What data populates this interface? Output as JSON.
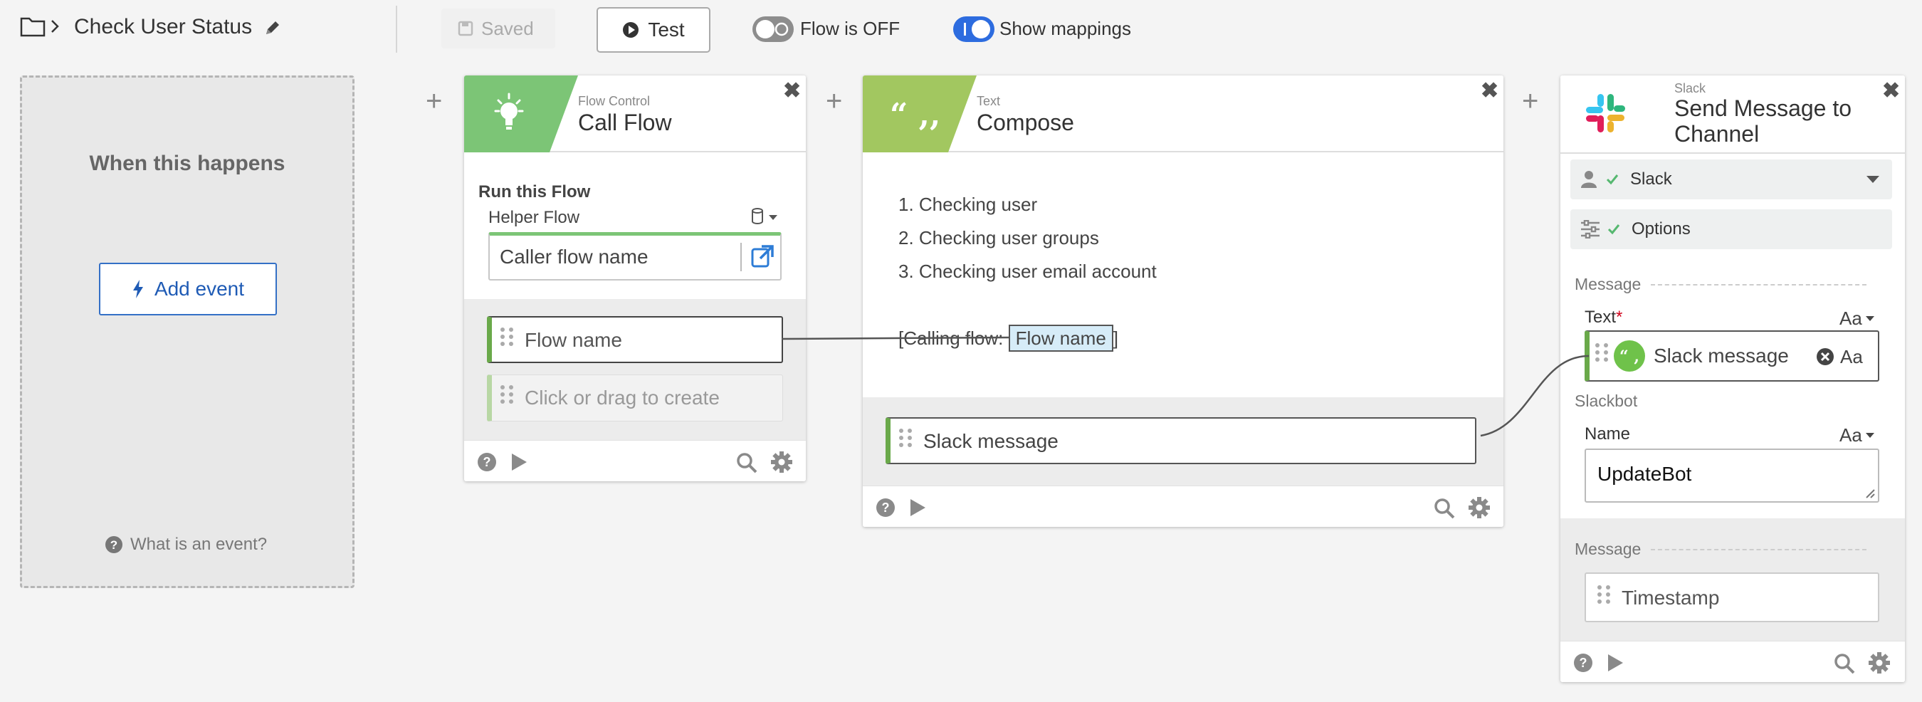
{
  "toolbar": {
    "title": "Check User Status",
    "saved_label": "Saved",
    "test_label": "Test",
    "flow_toggle_label": "Flow is OFF",
    "mappings_toggle_label": "Show mappings"
  },
  "trigger": {
    "title": "When this happens",
    "add_event_label": "Add event",
    "help_label": "What is an event?"
  },
  "call_flow": {
    "category": "Flow Control",
    "title": "Call Flow",
    "run_label": "Run this Flow",
    "helper_label": "Helper Flow",
    "helper_value": "Caller flow name",
    "inputs": [
      "Flow name"
    ],
    "create_placeholder": "Click or drag to create",
    "accent": "#7cc576"
  },
  "compose": {
    "category": "Text",
    "title": "Compose",
    "lines": [
      "1. Checking user",
      "2. Checking user groups",
      "3. Checking user email account"
    ],
    "calling_prefix": "[Calling flow: ",
    "calling_token": "Flow name",
    "calling_suffix": "]",
    "output": "Slack message",
    "accent": "#a2c760"
  },
  "slack": {
    "category": "Slack",
    "title_line1": "Send Message to",
    "title_line2": "Channel",
    "connection": "Slack",
    "options": "Options",
    "message_section": "Message",
    "text_label": "Text",
    "required_mark": "*",
    "text_token": "Slack message",
    "aa": "Aa",
    "slackbot_section": "Slackbot",
    "name_label": "Name",
    "name_value": "UpdateBot",
    "message_section2": "Message",
    "timestamp": "Timestamp"
  },
  "colors": {
    "accent_blue": "#2d6cdf",
    "token_green": "#6fc24a",
    "mapping_token_bg": "#d6ecf8"
  }
}
